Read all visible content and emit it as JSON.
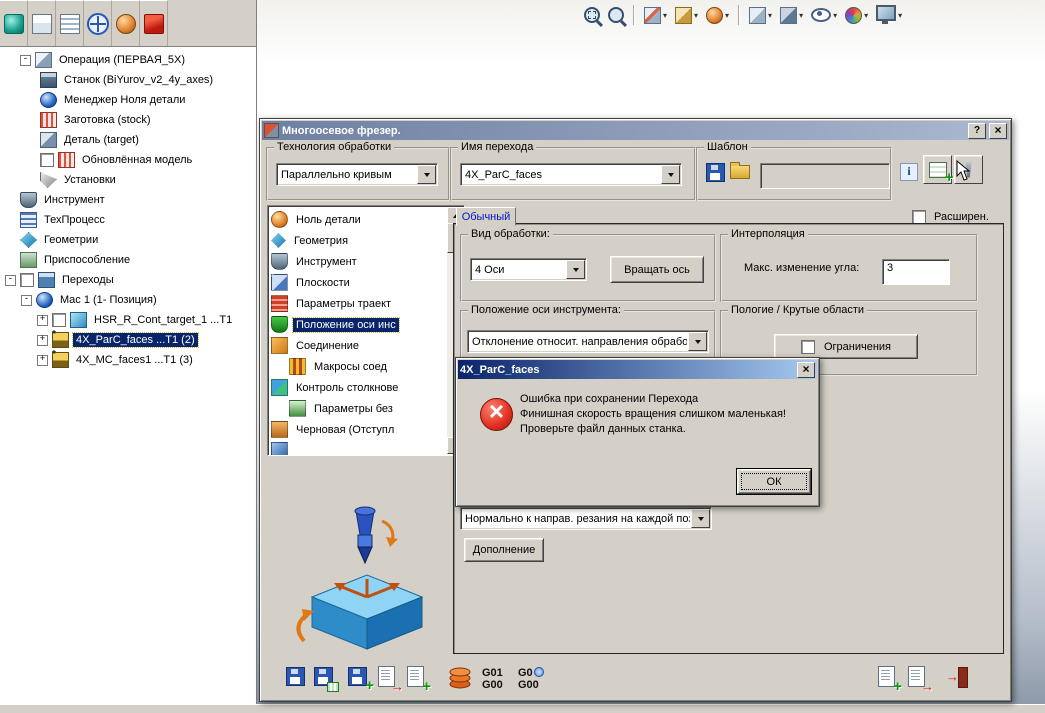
{
  "colors": {
    "selection": "#0a246a",
    "dialog_face": "#d4d0c8",
    "active_title_start": "#0a246a",
    "active_title_end": "#a6caf0",
    "inactive_title_start": "#6e80a2",
    "inactive_title_end": "#aab8cf",
    "error_red": "#d83020"
  },
  "left_panel": {
    "tabs": [
      {
        "name": "solidcam-manager-tab"
      },
      {
        "name": "feature-manager-tab"
      },
      {
        "name": "property-manager-tab"
      },
      {
        "name": "configuration-manager-tab"
      },
      {
        "name": "appearances-manager-tab"
      },
      {
        "name": "solidcam-tab"
      }
    ],
    "tree": {
      "items": [
        {
          "label": "Операция (ПЕРВАЯ_5X)",
          "expander": "collapse",
          "icon": "operation-cube-icon"
        },
        {
          "label": "Станок (BiYurov_v2_4y_axes)",
          "icon": "machine-icon"
        },
        {
          "label": "Менеджер Ноля детали",
          "icon": "zero-manager-icon"
        },
        {
          "label": "Заготовка (stock)",
          "icon": "stock-icon"
        },
        {
          "label": "Деталь (target)",
          "icon": "target-icon"
        },
        {
          "label": "Обновлённая модель",
          "checkbox": false,
          "icon": "updated-model-icon"
        },
        {
          "label": "Установки",
          "icon": "setups-icon"
        },
        {
          "label": "Инструмент",
          "icon": "tool-icon"
        },
        {
          "label": "ТехПроцесс",
          "icon": "process-table-icon"
        },
        {
          "label": "Геометрии",
          "icon": "geometry-icon"
        },
        {
          "label": "Приспособление",
          "icon": "fixture-icon"
        },
        {
          "label": "Переходы",
          "expander": "collapse",
          "checkbox": false,
          "icon": "operations-icon"
        },
        {
          "label": "Mac 1 (1- Позиция)",
          "expander": "collapse",
          "icon": "position-icon"
        },
        {
          "label": "HSR_R_Cont_target_1 ...T1",
          "expander": "expand",
          "checkbox": false,
          "icon": "hsr-operation-icon"
        },
        {
          "label": "4X_ParC_faces ...T1 (2)",
          "expander": "expand",
          "selected": true,
          "icon": "mill-operation-icon"
        },
        {
          "label": "4X_MC_faces1 ...T1 (3)",
          "expander": "expand",
          "icon": "mill-operation-icon"
        }
      ]
    }
  },
  "top_toolbar": {
    "icons": [
      "zoom-window-icon",
      "zoom-fit-icon",
      "section-view-icon",
      "view-settings-icon",
      "appearance-sphere-icon",
      "view-orientation-icon",
      "display-style-icon",
      "hide-show-icon",
      "appearances-icon",
      "scene-icon"
    ]
  },
  "dialog": {
    "title": "Многоосевое фрезер.",
    "technology_group": {
      "label": "Технология обработки",
      "value": "Параллельно кривым"
    },
    "name_group": {
      "label": "Имя перехода",
      "value": "4X_ParC_faces"
    },
    "template_group": {
      "label": "Шаблон",
      "field_value": ""
    },
    "tab_label": "Обычный",
    "advanced_checkbox": {
      "label": "Расширен.",
      "checked": false
    },
    "sidebar_items": [
      {
        "label": "Ноль детали",
        "icon": "origin-icon"
      },
      {
        "label": "Геометрия",
        "icon": "geometry-icon"
      },
      {
        "label": "Инструмент",
        "icon": "tool-icon"
      },
      {
        "label": "Плоскости",
        "icon": "planes-icon"
      },
      {
        "label": "Параметры траект",
        "icon": "path-parameters-icon"
      },
      {
        "label": "Положение оси инс",
        "icon": "tool-axis-icon",
        "selected": true
      },
      {
        "label": "Соединение",
        "icon": "link-icon"
      },
      {
        "label": "Макросы соед",
        "icon": "macros-icon",
        "indent": true
      },
      {
        "label": "Контроль столкнове",
        "icon": "collision-control-icon"
      },
      {
        "label": "Параметры без",
        "icon": "safety-parameters-icon",
        "indent": true
      },
      {
        "label": "Черновая (Отступл",
        "icon": "roughing-icon"
      }
    ],
    "machining_group": {
      "label": "Вид обработки:",
      "value": "4 Оси",
      "button": "Вращать ось"
    },
    "interpolation_group": {
      "label": "Интерполяция",
      "field_label": "Макс. изменение угла:",
      "value": "3"
    },
    "tool_axis_group": {
      "label": "Положение оси инструмента:",
      "value": "Отклонение относит. направления обработк"
    },
    "areas_group": {
      "label": "Пологие / Крутые области",
      "button": "Ограничения",
      "checked": false
    },
    "normal_dropdown": "Нормально к направ. резания на каждой пози",
    "addition_button": "Дополнение",
    "gcode": {
      "g01": "G01",
      "g00a": "G00",
      "g0": "G0",
      "g00b": "G00"
    }
  },
  "error_dialog": {
    "title": "4X_ParC_faces",
    "message_lines": [
      "Ошибка при сохранении Перехода",
      "Финишная скорость вращения слишком маленькая!",
      "Проверьте файл данных станка."
    ],
    "ok_label": "ОК"
  }
}
